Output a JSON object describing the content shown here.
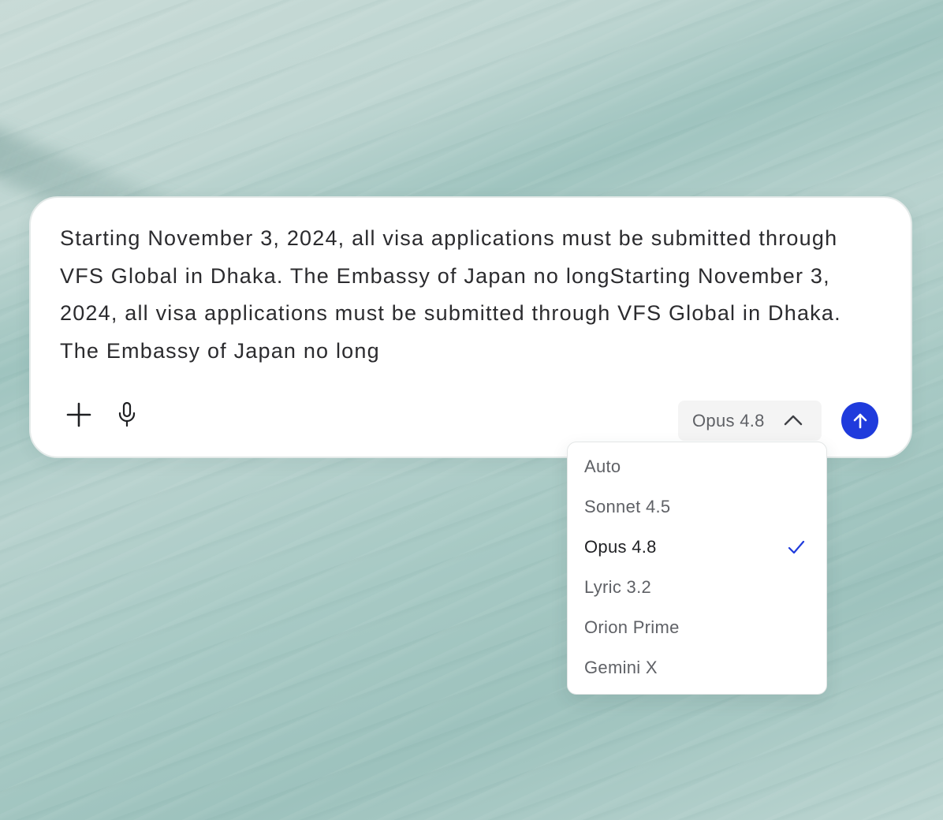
{
  "composer": {
    "prompt_text": "Starting November 3, 2024, all visa applications must be submitted through VFS Global in Dhaka. The Embassy of Japan no longStarting November 3, 2024, all visa applications must be submitted through VFS Global in Dhaka. The Embassy of Japan no long",
    "add_icon": "plus-icon",
    "mic_icon": "microphone-icon",
    "send_icon": "arrow-up-icon"
  },
  "model_selector": {
    "selected_label": "Opus 4.8",
    "chevron_icon": "chevron-up-icon",
    "expanded": true
  },
  "model_menu": {
    "options": [
      {
        "label": "Auto",
        "selected": false
      },
      {
        "label": "Sonnet 4.5",
        "selected": false
      },
      {
        "label": "Opus 4.8",
        "selected": true
      },
      {
        "label": "Lyric 3.2",
        "selected": false
      },
      {
        "label": "Orion Prime",
        "selected": false
      },
      {
        "label": "Gemini X",
        "selected": false
      }
    ],
    "check_icon": "checkmark-icon"
  },
  "colors": {
    "accent": "#1f3bdc",
    "text_primary": "#2b2b2e",
    "text_secondary": "#5f6166"
  }
}
